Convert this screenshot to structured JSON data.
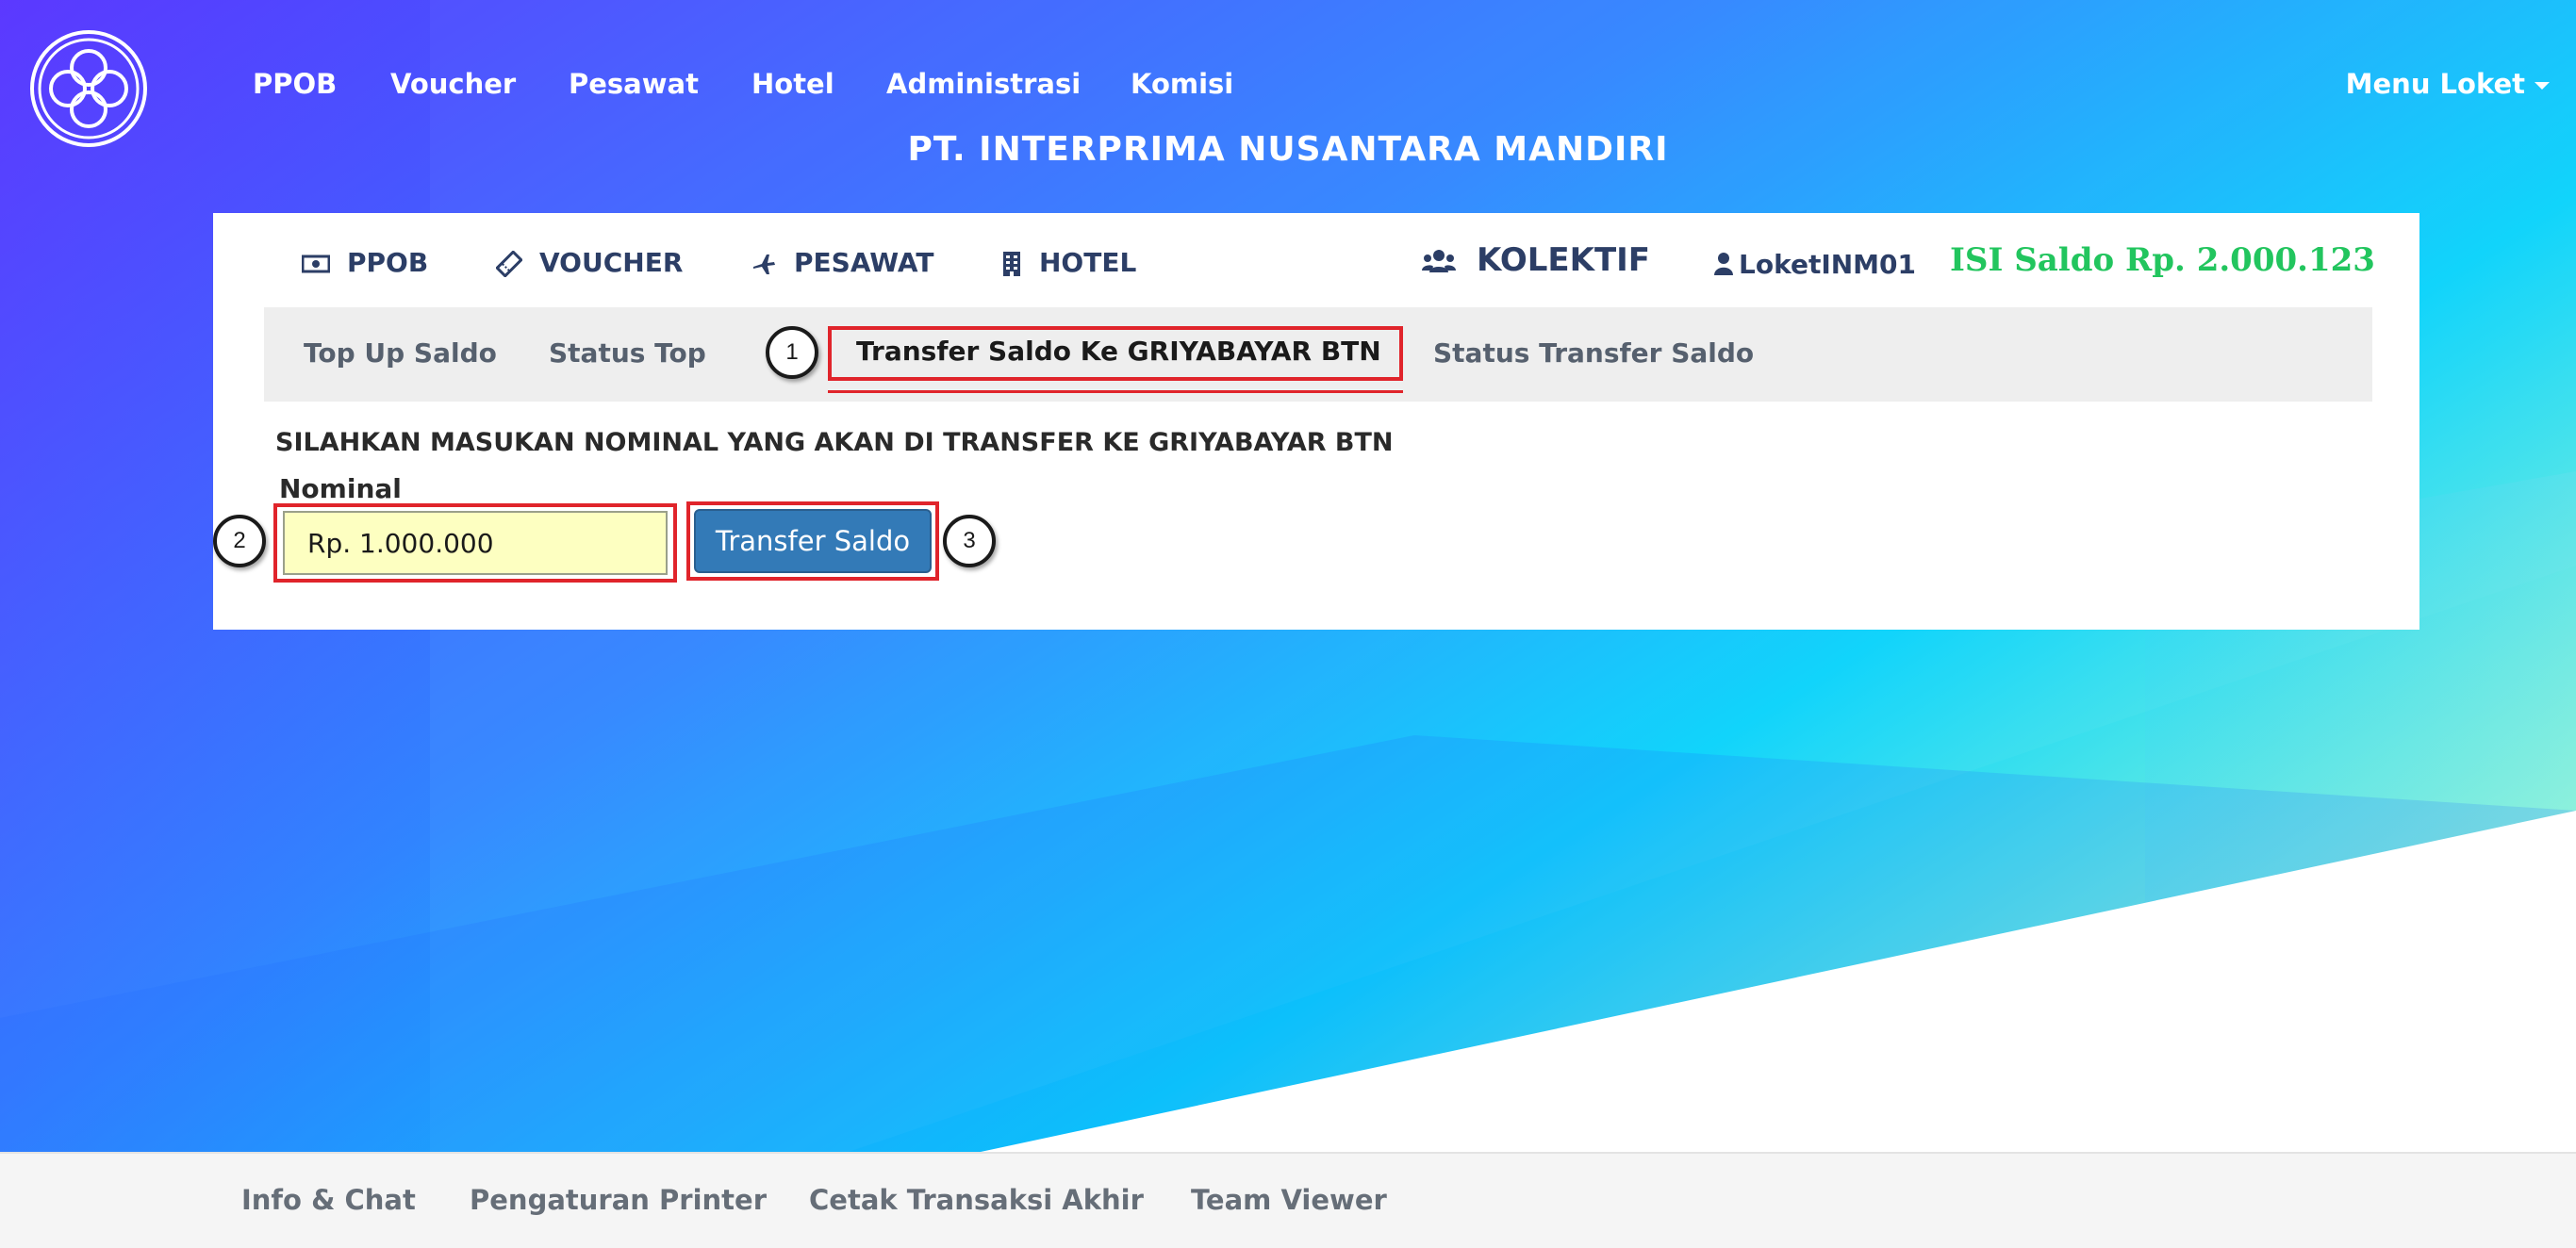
{
  "colors": {
    "accent_green": "#22c55e",
    "nav_text": "#2c3e66",
    "highlight_red": "#e0242b",
    "button_blue": "#337ab7",
    "input_bg": "#fdffc1"
  },
  "top_nav": {
    "logo_icon": "flower-logo-icon",
    "items": [
      "PPOB",
      "Voucher",
      "Pesawat",
      "Hotel",
      "Administrasi",
      "Komisi"
    ],
    "menu_loket": "Menu Loket",
    "company": "PT. INTERPRIMA NUSANTARA MANDIRI"
  },
  "categories": [
    {
      "label": "PPOB",
      "icon": "money-icon"
    },
    {
      "label": "VOUCHER",
      "icon": "ticket-icon"
    },
    {
      "label": "PESAWAT",
      "icon": "plane-icon"
    },
    {
      "label": "HOTEL",
      "icon": "building-icon"
    }
  ],
  "kolektif": {
    "label": "KOLEKTIF",
    "icon": "users-icon"
  },
  "user": {
    "name": "LoketINM01",
    "icon": "user-icon"
  },
  "saldo": "ISI Saldo Rp. 2.000.123",
  "tabs": [
    "Top Up Saldo",
    "Status Top",
    "Transfer Saldo Ke GRIYABAYAR BTN",
    "Status Transfer Saldo"
  ],
  "active_tab": "Transfer Saldo Ke GRIYABAYAR BTN",
  "instruction": "SILAHKAN MASUKAN NOMINAL YANG AKAN DI TRANSFER KE GRIYABAYAR BTN",
  "form": {
    "nominal_label": "Nominal",
    "nominal_value": "Rp. 1.000.000",
    "button_label": "Transfer Saldo"
  },
  "callouts": [
    "1",
    "2",
    "3"
  ],
  "footer": [
    "Info & Chat",
    "Pengaturan Printer",
    "Cetak Transaksi Akhir",
    "Team Viewer"
  ]
}
